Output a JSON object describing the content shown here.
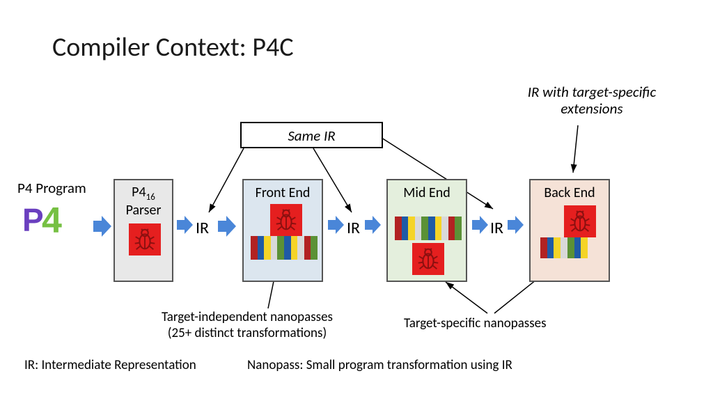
{
  "title": "Compiler Context: P4C",
  "annotations": {
    "ir_extensions": "IR with target-specific extensions",
    "same_ir": "Same IR",
    "target_independent_line1": "Target-independent nanopasses",
    "target_independent_line2": "(25+ distinct transformations)",
    "target_specific": "Target-specific nanopasses"
  },
  "input": {
    "label": "P4 Program",
    "logo_text": "P4"
  },
  "stages": {
    "parser": {
      "name_line1": "P4",
      "name_sub": "16",
      "name_line2": "Parser"
    },
    "front": {
      "name": "Front End"
    },
    "mid": {
      "name": "Mid End"
    },
    "back": {
      "name": "Back End"
    }
  },
  "ir_label": "IR",
  "barcode_colors": [
    "#b22222",
    "#1f5aa6",
    "#f5d427",
    "#d9d9d9",
    "#5b9136",
    "#1f5aa6",
    "#f5d427",
    "#d9d9d9",
    "#b22222",
    "#5b9136"
  ],
  "defs": {
    "ir": "IR: Intermediate Representation",
    "nanopass": "Nanopass: Small program transformation using IR"
  },
  "colors": {
    "arrow_blue": "#4a86d8",
    "bug_bg": "#e51f1f",
    "bug_stroke": "#8c1010"
  }
}
